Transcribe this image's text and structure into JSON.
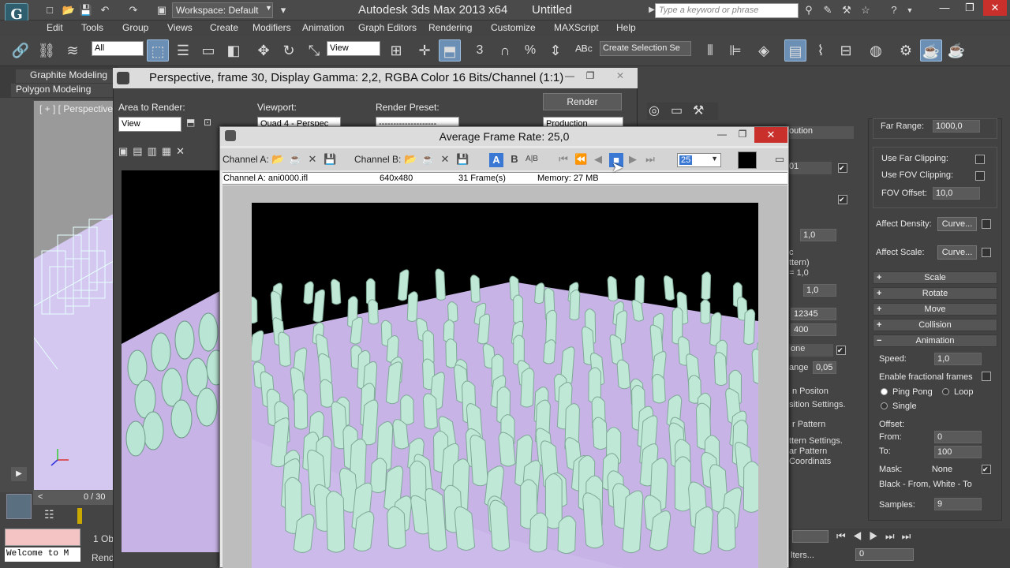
{
  "app": {
    "title": "Autodesk 3ds Max  2013 x64",
    "doc": "Untitled",
    "workspace": "Workspace: Default",
    "search_placeholder": "Type a keyword or phrase",
    "logo": "G"
  },
  "menu": [
    "Edit",
    "Tools",
    "Group",
    "Views",
    "Create",
    "Modifiers",
    "Animation",
    "Graph Editors",
    "Rendering",
    "Customize",
    "MAXScript",
    "Help"
  ],
  "toolbar": {
    "filter": "All",
    "refcoord": "View",
    "selection_set": "Create Selection Se",
    "numbers": [
      "3",
      "%"
    ]
  },
  "ribbon": {
    "graphite": "Graphite Modeling",
    "polygon": "Polygon Modeling"
  },
  "viewport": {
    "label": "[ + ] [ Perspective ]",
    "frames": "0 / 30"
  },
  "status": {
    "objects": "1 Obj",
    "welcome": "Welcome to M",
    "render": "Rend"
  },
  "render_frame_window": {
    "title": "Perspective, frame 30, Display Gamma: 2,2, RGBA Color 16 Bits/Channel (1:1)",
    "area_label": "Area to Render:",
    "area_value": "View",
    "viewport_label": "Viewport:",
    "viewport_value": "Quad 4 - Perspec",
    "preset_label": "Render Preset:",
    "preset_value": "--------------------",
    "render_btn": "Render",
    "production": "Production"
  },
  "frame_rate_window": {
    "title": "Average Frame Rate: 25,0",
    "channel_a": "Channel A:",
    "channel_b": "Channel B:",
    "frame_input": "25",
    "info": {
      "channel": "Channel A: ani0000.ifl",
      "size": "640x480",
      "frames": "31 Frame(s)",
      "memory": "Memory: 27 MB"
    }
  },
  "command_panel": {
    "far_range_label": "Far Range:",
    "far_range": "1000,0",
    "use_far": "Use Far Clipping:",
    "use_fov": "Use FOV Clipping:",
    "fov_offset_label": "FOV Offset:",
    "fov_offset": "10,0",
    "affect_density": "Affect Density:",
    "affect_scale": "Affect Scale:",
    "curve": "Curve...",
    "rollouts": [
      "Scale",
      "Rotate",
      "Move",
      "Collision",
      "Animation"
    ],
    "speed_label": "Speed:",
    "speed": "1,0",
    "enable_fractional": "Enable fractional frames",
    "ping_pong": "Ping Pong",
    "loop": "Loop",
    "single": "Single",
    "offset_label": "Offset:",
    "from_label": "From:",
    "from": "0",
    "to_label": "To:",
    "to": "100",
    "mask_label": "Mask:",
    "mask_value": "None",
    "black_white": "Black - From,  White - To",
    "samples_label": "Samples:",
    "samples": "9",
    "mid": {
      "ution": "oution",
      "val1": "01",
      "spin1": "1,0",
      "pattern": "c\nttern)\n= 1,0",
      "spin2": "1,0",
      "seed": "12345",
      "val400": "400",
      "one": "one",
      "range_lbl": "ange",
      "range_val": "0,05",
      "pos": "n Positon",
      "sition": "sition Settings.",
      "rpattern": "r Pattern",
      "ttern_set": "ttern Settings.",
      "ar_pattern": "ar Pattern",
      "coordinats": "Coordinats"
    }
  },
  "bottom": {
    "frame": "0",
    "filters": "lters..."
  }
}
